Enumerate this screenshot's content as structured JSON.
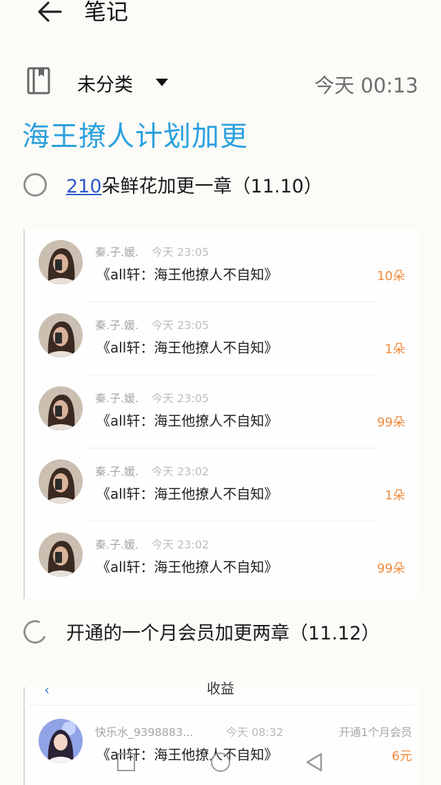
{
  "header": {
    "title": "笔记"
  },
  "meta": {
    "category": "未分类",
    "timestamp": "今天 00:13"
  },
  "note": {
    "title": "海王撩人计划加更"
  },
  "todos": [
    {
      "link": "210",
      "text": "朵鲜花加更一章（11.10）"
    },
    {
      "text": "开通的一个月会员加更两章（11.12）"
    }
  ],
  "gifts": [
    {
      "name": "秦.子.媛.",
      "time": "今天 23:05",
      "book": "《all轩：海王他撩人不自知》",
      "amount": "10朵"
    },
    {
      "name": "秦.子.媛.",
      "time": "今天 23:05",
      "book": "《all轩：海王他撩人不自知》",
      "amount": "1朵"
    },
    {
      "name": "秦.子.媛.",
      "time": "今天 23:05",
      "book": "《all轩：海王他撩人不自知》",
      "amount": "99朵"
    },
    {
      "name": "秦.子.媛.",
      "time": "今天 23:02",
      "book": "《all轩：海王他撩人不自知》",
      "amount": "1朵"
    },
    {
      "name": "秦.子.媛.",
      "time": "今天 23:02",
      "book": "《all轩：海王他撩人不自知》",
      "amount": "99朵"
    }
  ],
  "member_card": {
    "cut_label": "收益",
    "name": "快乐水_9398883...",
    "time": "今天 08:32",
    "type": "开通1个月会员",
    "book": "《all轩：海王他撩人不自知》",
    "price": "6元"
  },
  "colors": {
    "title_blue": "#2aa0de",
    "link_blue": "#2b58c9",
    "gift_orange": "#f08a3c"
  }
}
